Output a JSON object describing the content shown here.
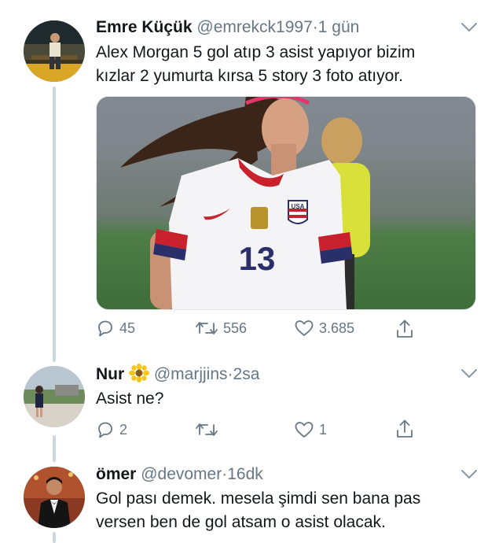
{
  "tweets": [
    {
      "name": "Emre Küçük",
      "handle": "@emrekck1997",
      "sep": "·",
      "time": "1 gün",
      "text_line1": "Alex Morgan 5 gol atıp 3 asist yapıyor bizim",
      "text_line2": "kızlar 2 yumurta kırsa 5 story 3 foto atıyor.",
      "replies": "45",
      "retweets": "556",
      "likes": "3.685"
    },
    {
      "name": "Nur",
      "handle": "@marjjins",
      "sep": "·",
      "time": "2sa",
      "text_line1": "Asist ne?",
      "replies": "2",
      "retweets": "",
      "likes": "1"
    },
    {
      "name": "ömer",
      "handle": "@devomer",
      "sep": "·",
      "time": "16dk",
      "text_line1": "Gol pası demek. mesela şimdi sen bana pas",
      "text_line2": "versen ben de gol atsam o asist olacak."
    }
  ],
  "media": {
    "jersey_number": "13",
    "crest_text": "USA"
  },
  "icons": {
    "reply": "reply-icon",
    "retweet": "retweet-icon",
    "like": "heart-icon",
    "share": "share-icon",
    "more": "chevron-down-icon",
    "name_emoji": "sunflower-icon"
  },
  "colors": {
    "text": "#14171a",
    "muted": "#657786",
    "thread_line": "#ccd6dd"
  }
}
